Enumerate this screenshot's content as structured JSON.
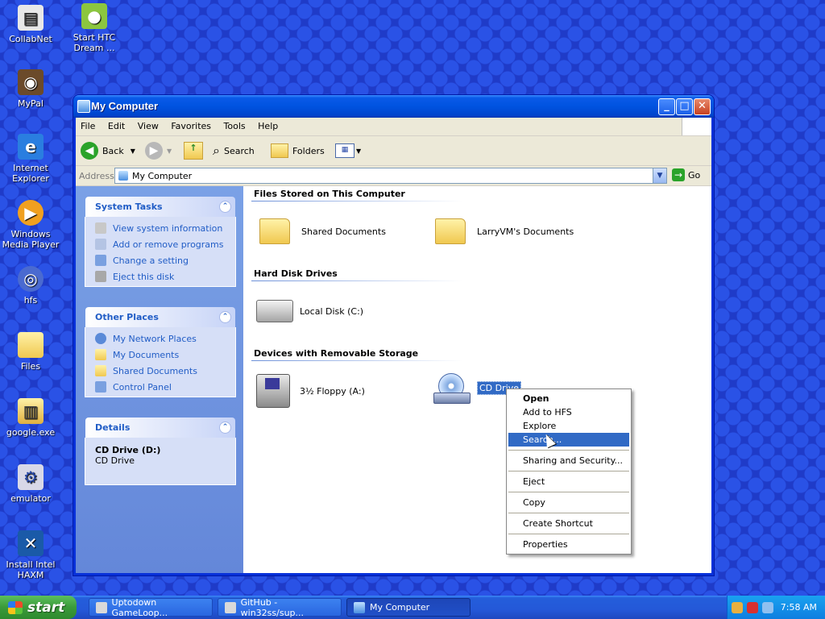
{
  "desktop": {
    "icons": [
      {
        "label": "CollabNet"
      },
      {
        "label": "Start HTC Dream ..."
      },
      {
        "label": "MyPal"
      },
      {
        "label": "Internet Explorer"
      },
      {
        "label": "Windows Media Player"
      },
      {
        "label": "hfs"
      },
      {
        "label": "Files"
      },
      {
        "label": "google.exe"
      },
      {
        "label": "emulator"
      },
      {
        "label": "Install Intel HAXM"
      }
    ]
  },
  "window": {
    "title": "My Computer",
    "menu": [
      "File",
      "Edit",
      "View",
      "Favorites",
      "Tools",
      "Help"
    ],
    "toolbar": {
      "back": "Back",
      "search": "Search",
      "folders": "Folders"
    },
    "address": {
      "label": "Address",
      "value": "My Computer",
      "go": "Go"
    }
  },
  "left_pane": {
    "system_tasks": {
      "title": "System Tasks",
      "items": [
        "View system information",
        "Add or remove programs",
        "Change a setting",
        "Eject this disk"
      ]
    },
    "other_places": {
      "title": "Other Places",
      "items": [
        "My Network Places",
        "My Documents",
        "Shared Documents",
        "Control Panel"
      ]
    },
    "details": {
      "title": "Details",
      "name": "CD Drive (D:)",
      "type": "CD Drive"
    }
  },
  "content": {
    "groups": [
      {
        "title": "Files Stored on This Computer",
        "items": [
          "Shared Documents",
          "LarryVM's Documents"
        ]
      },
      {
        "title": "Hard Disk Drives",
        "items": [
          "Local Disk (C:)"
        ]
      },
      {
        "title": "Devices with Removable Storage",
        "items": [
          "3½ Floppy (A:)",
          "CD Drive"
        ]
      }
    ]
  },
  "context_menu": {
    "items": [
      "Open",
      "Add to HFS",
      "Explore",
      "Search...",
      "Sharing and Security...",
      "Eject",
      "Copy",
      "Create Shortcut",
      "Properties"
    ]
  },
  "taskbar": {
    "start": "start",
    "tasks": [
      "Uptodown GameLoop...",
      "GitHub - win32ss/sup...",
      "My Computer"
    ],
    "clock": "7:58 AM"
  }
}
